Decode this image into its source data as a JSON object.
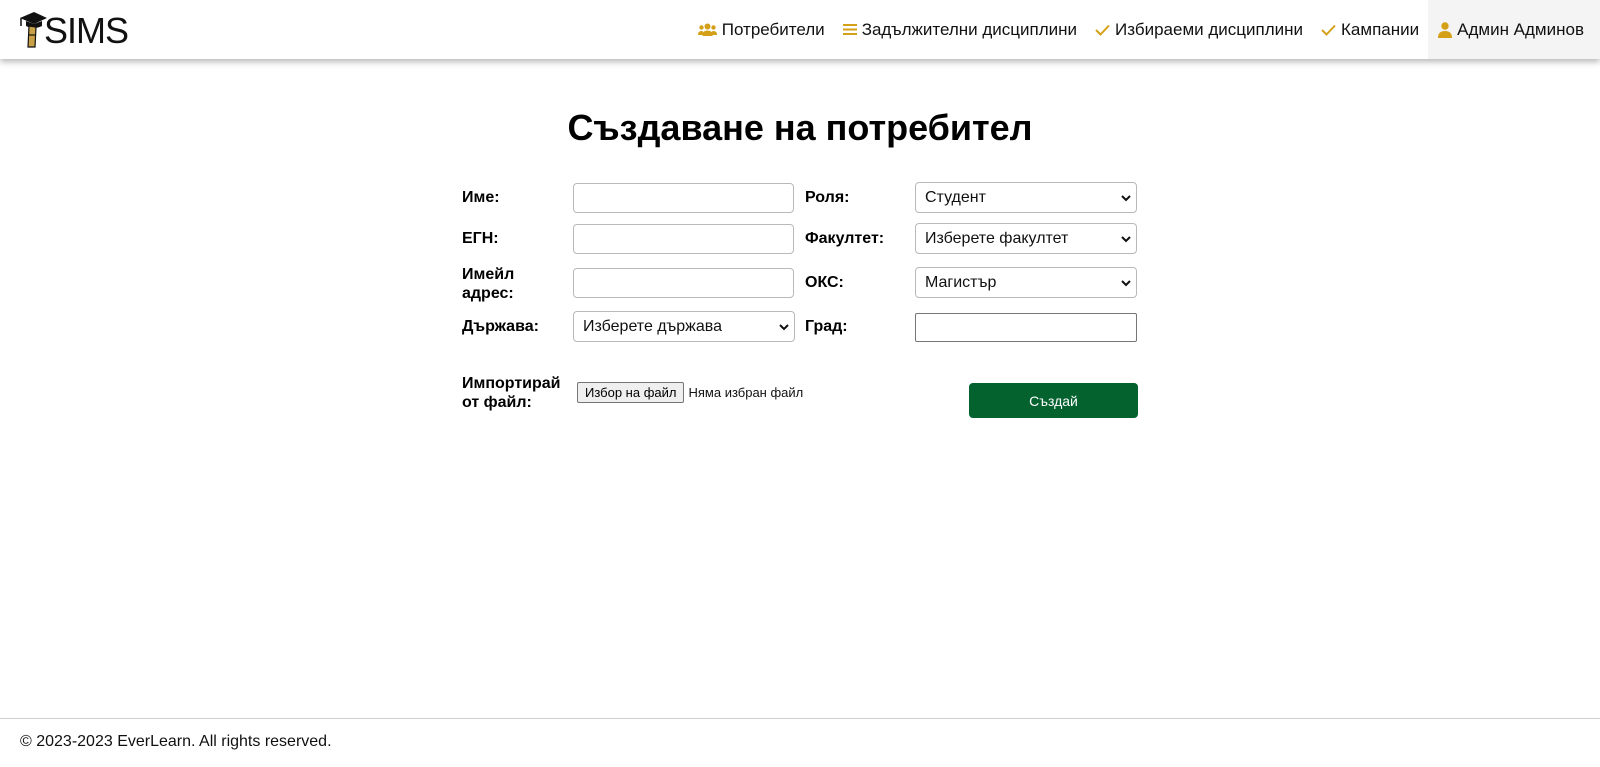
{
  "app": {
    "logo_text": "SIMS"
  },
  "nav": {
    "items": [
      {
        "label": "Потребители",
        "icon": "users-icon"
      },
      {
        "label": "Задължителни дисциплини",
        "icon": "list-icon"
      },
      {
        "label": "Избираеми дисциплини",
        "icon": "check-icon"
      },
      {
        "label": "Кампании",
        "icon": "check-icon"
      }
    ],
    "user": {
      "label": "Админ Админов",
      "icon": "user-icon"
    }
  },
  "colors": {
    "accent": "#d4a017",
    "primary_button": "#04622f"
  },
  "page": {
    "title": "Създаване на потребител"
  },
  "form": {
    "name_label": "Име:",
    "name_value": "",
    "role_label": "Роля:",
    "role_value": "Студент",
    "egn_label": "ЕГН:",
    "egn_value": "",
    "faculty_label": "Факултет:",
    "faculty_value": "Изберете факултет",
    "email_label_line1": "Имейл",
    "email_label_line2": "адрес:",
    "email_value": "",
    "oks_label": "ОКС:",
    "oks_value": "Магистър",
    "country_label": "Държава:",
    "country_value": "Изберете държава",
    "city_label": "Град:",
    "city_value": "",
    "import_label_line1": "Импортирай",
    "import_label_line2": "от файл:",
    "file_button": "Избор на файл",
    "file_status": "Няма избран файл",
    "submit": "Създай"
  },
  "footer": {
    "text": "© 2023-2023 EverLearn. All rights reserved."
  }
}
